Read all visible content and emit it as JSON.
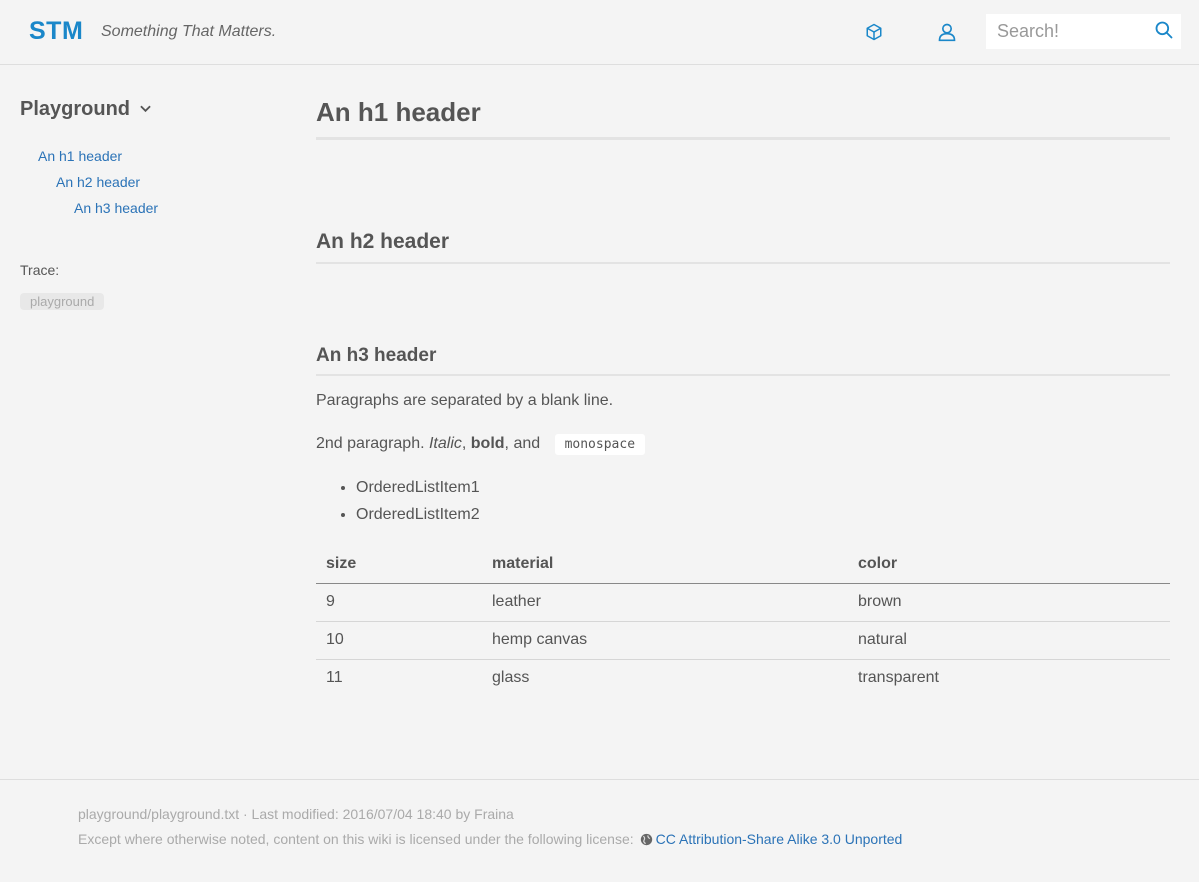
{
  "header": {
    "brand": "STM",
    "tagline": "Something That Matters.",
    "search_placeholder": "Search!",
    "icons": [
      "cube-icon",
      "user-icon",
      "search-icon"
    ],
    "accent_color": "#1a87c9"
  },
  "sidebar": {
    "title": "Playground",
    "toc": [
      {
        "label": "An h1 header",
        "level": 1
      },
      {
        "label": "An h2 header",
        "level": 2
      },
      {
        "label": "An h3 header",
        "level": 3
      }
    ],
    "trace_label": "Trace:",
    "trace_items": [
      "playground"
    ]
  },
  "content": {
    "h1": "An h1 header",
    "h2": "An h2 header",
    "h3": "An h3 header",
    "paragraph1": "Paragraphs are separated by a blank line.",
    "paragraph2": {
      "prefix": "2nd paragraph. ",
      "italic": "Italic",
      "sep1": ", ",
      "bold": "bold",
      "sep2": ", and ",
      "code": "monospace"
    },
    "list": [
      "OrderedListItem1",
      "OrderedListItem2"
    ],
    "table": {
      "headers": [
        "size",
        "material",
        "color"
      ],
      "rows": [
        [
          "9",
          "leather",
          "brown"
        ],
        [
          "10",
          "hemp canvas",
          "natural"
        ],
        [
          "11",
          "glass",
          "transparent"
        ]
      ]
    }
  },
  "footer": {
    "meta": "playground/playground.txt · Last modified: 2016/07/04 18:40 by Fraina",
    "license_prefix": "Except where otherwise noted, content on this wiki is licensed under the following license:",
    "license_link": "CC Attribution-Share Alike 3.0 Unported",
    "link_color": "#2b73b7"
  }
}
